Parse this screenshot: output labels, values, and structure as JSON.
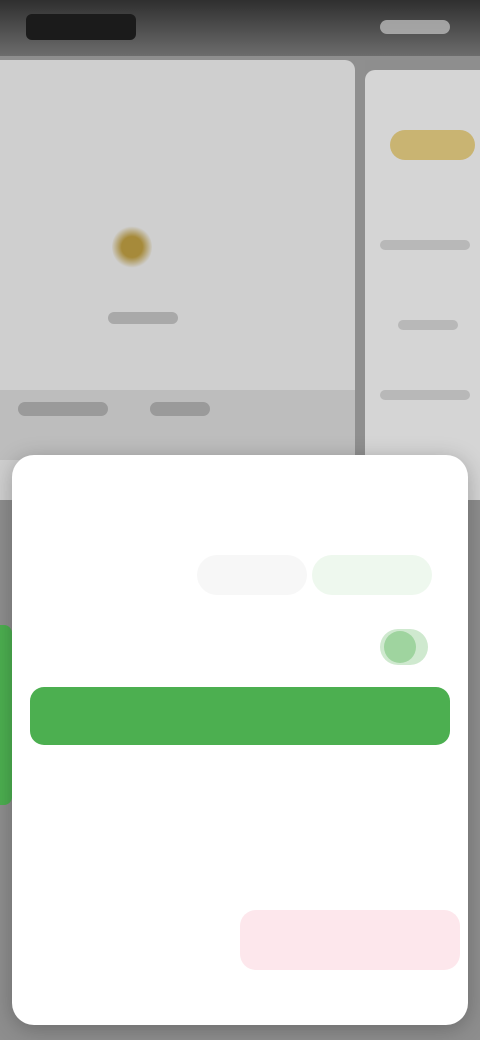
{
  "status_bar": {
    "time": ""
  },
  "sheet": {
    "title": "",
    "option1_label": "",
    "segment_a": "",
    "segment_b": "",
    "option2_label": "",
    "primary_button": "",
    "secondary_link": "",
    "action_a": "",
    "action_b": "",
    "action_c": "",
    "danger_action": ""
  },
  "colors": {
    "accent": "#4caf50",
    "danger_bg": "#fde7ec"
  }
}
